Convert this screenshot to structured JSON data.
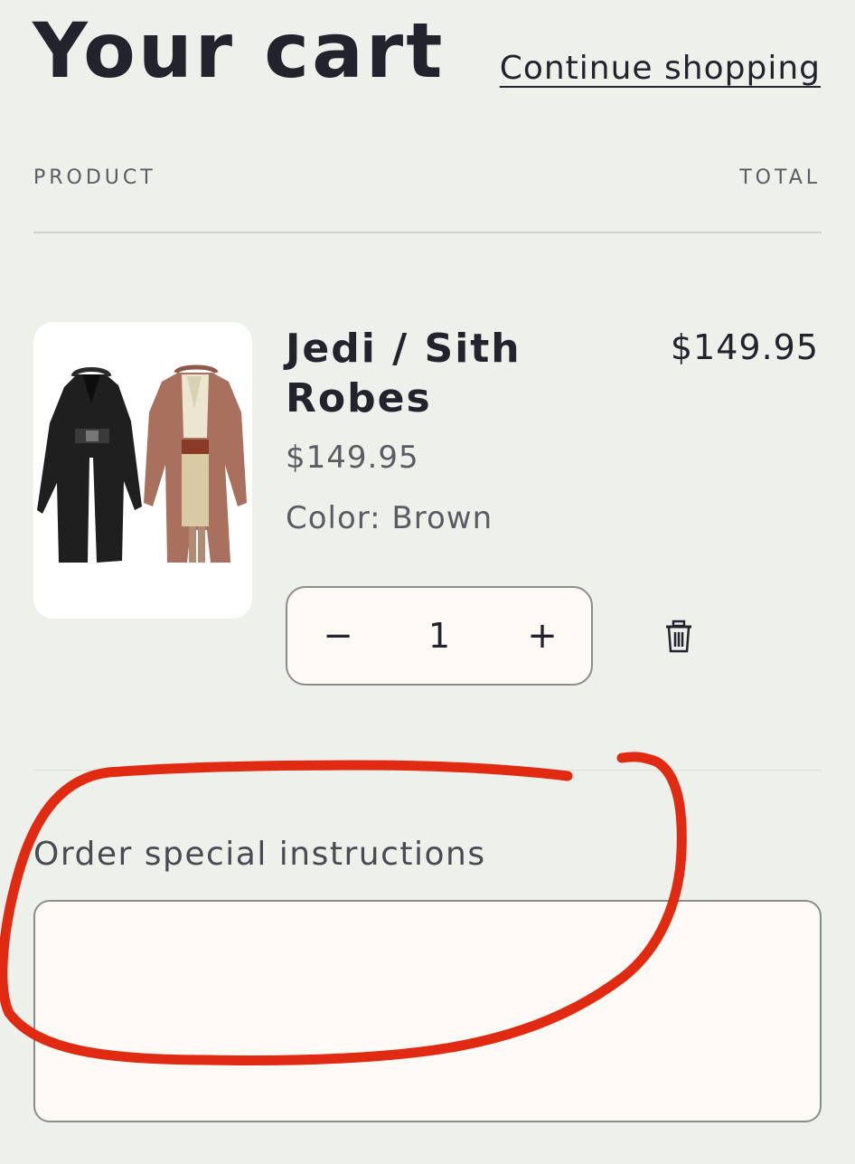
{
  "header": {
    "title": "Your cart",
    "continue_label": "Continue shopping"
  },
  "table": {
    "columns": [
      "PRODUCT",
      "TOTAL"
    ]
  },
  "item": {
    "name": "Jedi / Sith Robes",
    "price": "$149.95",
    "option": "Color: Brown",
    "line_total": "$149.95",
    "quantity": "1",
    "decrease_symbol": "−",
    "increase_symbol": "+",
    "image_icon": "robes-product-image",
    "remove_icon": "trash-icon"
  },
  "instructions": {
    "label": "Order special instructions",
    "value": ""
  },
  "annotation": {
    "color": "#e02a12",
    "shape": "hand-drawn-circle"
  }
}
